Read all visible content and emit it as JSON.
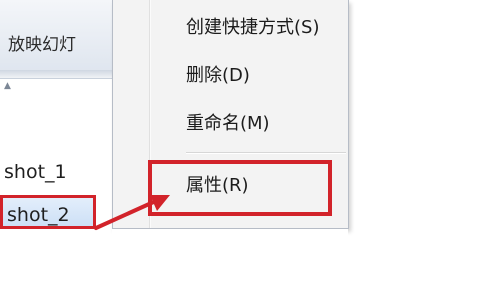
{
  "ribbon": {
    "tab_slideshow": "放映幻灯"
  },
  "files": [
    {
      "name": "shot_1",
      "selected": false
    },
    {
      "name": "shot_2",
      "selected": true
    }
  ],
  "context_menu": {
    "items": [
      {
        "label": "创建快捷方式(S)"
      },
      {
        "label": "删除(D)"
      },
      {
        "label": "重命名(M)"
      },
      {
        "label": "属性(R)"
      }
    ]
  },
  "colors": {
    "annotation_red": "#d2232a",
    "selection_blue": "#cde0f6",
    "menu_bg": "#f3f3f3"
  }
}
